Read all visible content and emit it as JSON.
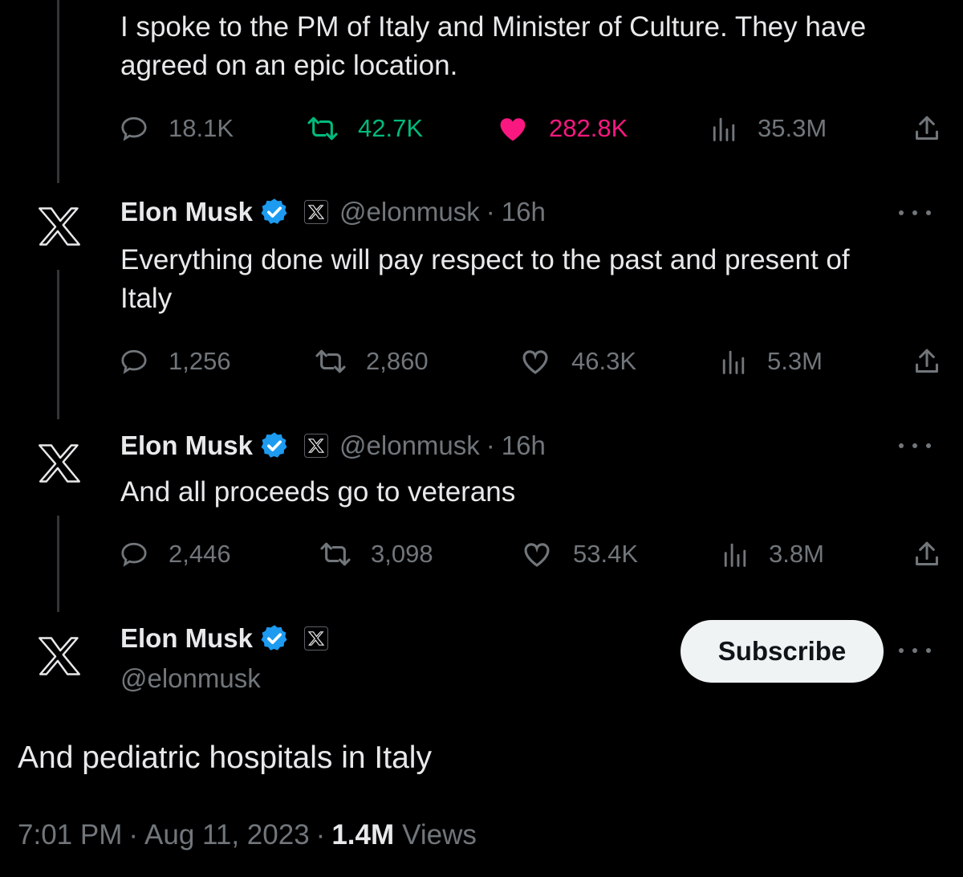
{
  "top_tweet": {
    "text_line1": "I spoke to the PM of Italy and Minister of Culture. They have",
    "text_line2": "agreed on an epic location.",
    "actions": {
      "replies": "18.1K",
      "retweets": "42.7K",
      "likes": "282.8K",
      "views": "35.3M"
    }
  },
  "reply1": {
    "name": "Elon Musk",
    "handle": "@elonmusk",
    "time": "16h",
    "text_line1": "Everything done will pay respect to the past and present of",
    "text_line2": "Italy",
    "actions": {
      "replies": "1,256",
      "retweets": "2,860",
      "likes": "46.3K",
      "views": "5.3M"
    }
  },
  "reply2": {
    "name": "Elon Musk",
    "handle": "@elonmusk",
    "time": "16h",
    "text": "And all proceeds go to veterans",
    "actions": {
      "replies": "2,446",
      "retweets": "3,098",
      "likes": "53.4K",
      "views": "3.8M"
    }
  },
  "main_tweet": {
    "name": "Elon Musk",
    "handle": "@elonmusk",
    "subscribe_label": "Subscribe",
    "text": "And pediatric hospitals in Italy",
    "time": "7:01 PM",
    "date": "Aug 11, 2023",
    "views_count": "1.4M",
    "views_label": "Views"
  },
  "separator": "·",
  "colors": {
    "background": "#000000",
    "text": "#e7e9ea",
    "muted": "#71767b",
    "retweet_active": "#00ba7c",
    "like_active": "#f91880",
    "verified": "#1d9bf0"
  }
}
